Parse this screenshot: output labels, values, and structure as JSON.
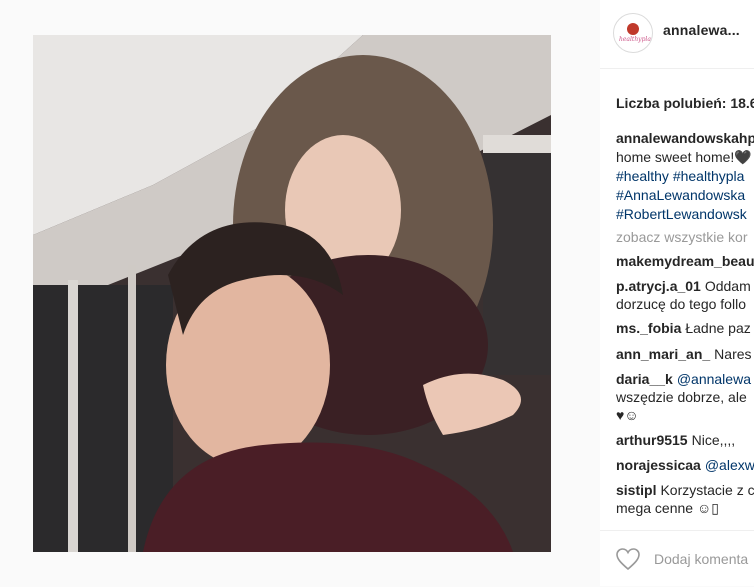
{
  "post": {
    "username": "annalewa...",
    "likes_text": "Liczba polubień: 18.6",
    "caption": {
      "user": "annalewandowskahp",
      "line1": "home sweet home!🖤",
      "line2": "#healthy #healthypla",
      "line3": "#AnnaLewandowska",
      "line4": "#RobertLewandowsk"
    },
    "view_all": "zobacz wszystkie kor",
    "comments": [
      {
        "user": "makemydream_beau",
        "text": ""
      },
      {
        "user": "p.atrycj.a_01",
        "text": "Oddam",
        "text2": "dorzucę do tego follo"
      },
      {
        "user": "ms._fobia",
        "text": "Ładne paz"
      },
      {
        "user": "ann_mari_an_",
        "text": "Nares"
      },
      {
        "user": "daria__k",
        "mention": "@annalewa",
        "text2": "wszędzie dobrze, ale",
        "text3": "♥☺"
      },
      {
        "user": "arthur9515",
        "text": "Nice,,,,"
      },
      {
        "user": "norajessicaa",
        "mention": "@alexw"
      },
      {
        "user": "sistipl",
        "text": "Korzystacie z c",
        "text2": "mega cenne ☺▯"
      }
    ],
    "add_comment_placeholder": "Dodaj komenta"
  }
}
